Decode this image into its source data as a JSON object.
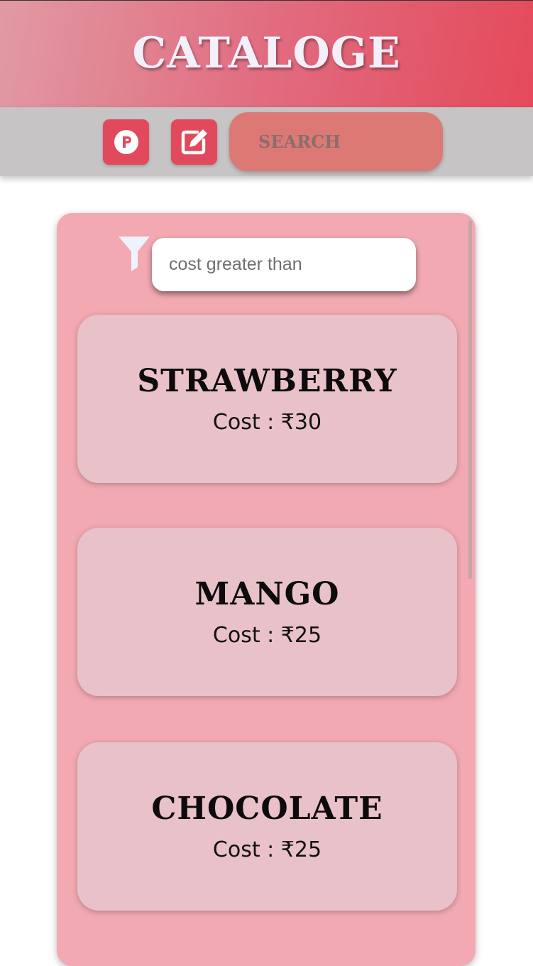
{
  "header": {
    "title": "CATALOGE"
  },
  "toolbar": {
    "buttons": [
      {
        "icon": "p-circle-icon"
      },
      {
        "icon": "edit-icon"
      }
    ],
    "search_label": "SEARCH"
  },
  "filter": {
    "icon": "filter-icon",
    "placeholder": "cost greater than"
  },
  "items": [
    {
      "name": "STRAWBERRY",
      "cost": "Cost : ₹30"
    },
    {
      "name": "MANGO",
      "cost": "Cost : ₹25"
    },
    {
      "name": "CHOCOLATE",
      "cost": "Cost : ₹25"
    }
  ],
  "colors": {
    "accent": "#e04a5c",
    "toolbar_bg": "#c6c4c5",
    "panel_bg": "#f2a9b2",
    "card_bg": "#e9c1c8",
    "search_bg": "#dc7974"
  }
}
